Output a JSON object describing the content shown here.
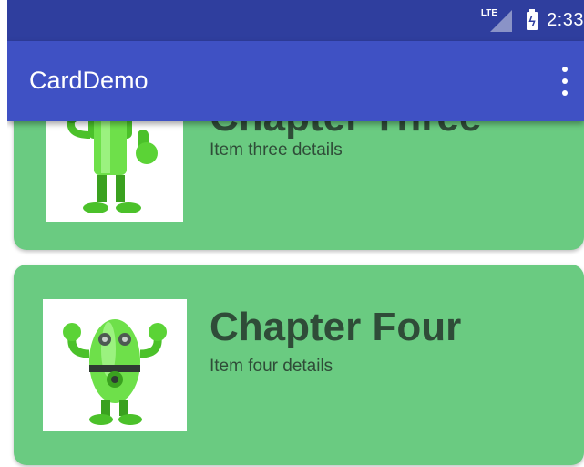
{
  "status_bar": {
    "network": "LTE",
    "time": "2:33"
  },
  "app_bar": {
    "title": "CardDemo",
    "overflow_icon": "more-vert-icon"
  },
  "cards": [
    {
      "title": "Chapter Three",
      "details": "Item three details",
      "image_icon": "android-robot-icon"
    },
    {
      "title": "Chapter Four",
      "details": "Item four details",
      "image_icon": "android-robot-icon"
    }
  ],
  "colors": {
    "status_bar": "#2f3e9e",
    "app_bar": "#3f51c4",
    "card": "#6acb81",
    "card_text": "#2f4c38"
  }
}
